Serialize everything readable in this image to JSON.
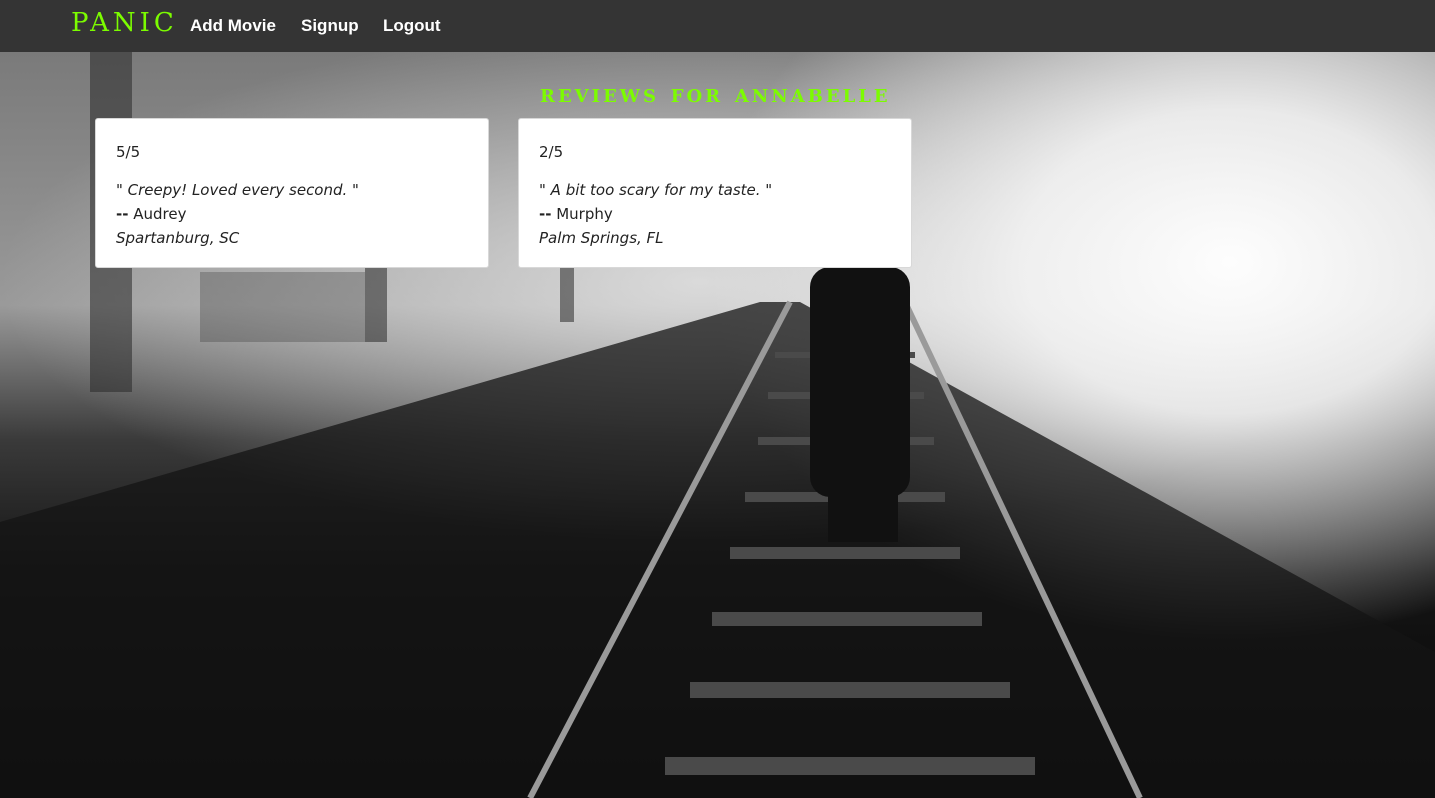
{
  "navbar": {
    "brand": "PANIC",
    "links": [
      "Add Movie",
      "Signup",
      "Logout"
    ]
  },
  "heading": "Reviews for Annabelle",
  "reviews": [
    {
      "rating": "5/5",
      "quote": "\" Creepy! Loved every second. \"",
      "dash": "--",
      "author": "Audrey",
      "location": "Spartanburg, SC"
    },
    {
      "rating": "2/5",
      "quote": "\" A bit too scary for my taste. \"",
      "dash": "--",
      "author": "Murphy",
      "location": "Palm Springs, FL"
    }
  ],
  "colors": {
    "brand": "#7cfc00",
    "navbar": "#343434",
    "card": "#ffffff"
  }
}
